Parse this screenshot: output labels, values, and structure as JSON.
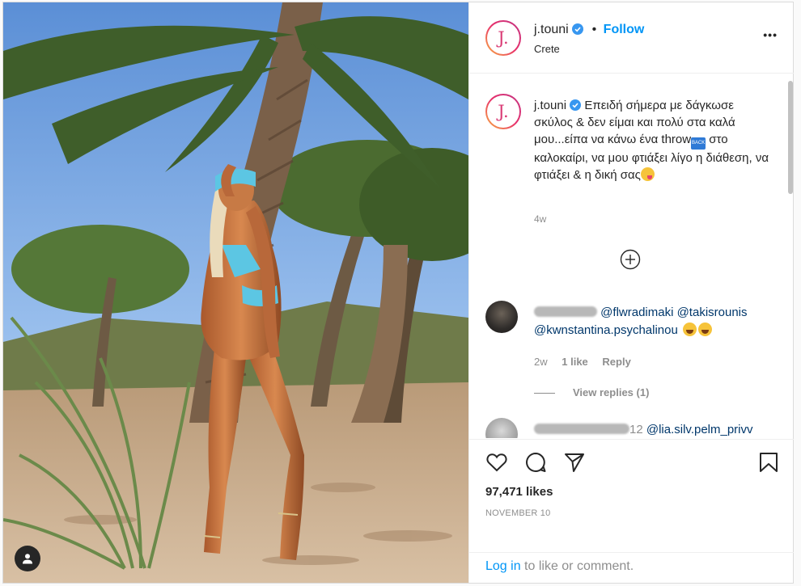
{
  "post": {
    "username": "j.touni",
    "avatar_letter": "J.",
    "location": "Crete",
    "follow_label": "Follow",
    "more_label": "•••",
    "caption": {
      "text_1": "Επειδή σήμερα με δάγκωσε σκύλος & δεν είμαι και πολύ στα καλά μου...είπα να κάνω ένα throw",
      "back_emoji": "BACK",
      "text_2": " στο καλοκαίρι, να μου φτιάξει λίγο η διάθεση, να φτιάξει & η δική σας",
      "time": "4w"
    },
    "comments": [
      {
        "mentions_1": "@flwradimaki @takisrounis",
        "mentions_2": "@kwnstantina.psychalinou",
        "time": "2w",
        "likes": "1 like",
        "reply_label": "Reply",
        "view_replies": "View replies (1)"
      },
      {
        "username_suffix": "12",
        "mentions_1": "@lia.silv.pelm_privv"
      }
    ],
    "likes": "97,471 likes",
    "date": "NOVEMBER 10",
    "login_link": "Log in",
    "login_text": " to like or comment.",
    "icons": [
      "heart-icon",
      "comment-icon",
      "share-icon",
      "bookmark-icon",
      "add-comment-icon",
      "verified-badge-icon",
      "user-tag-icon"
    ]
  }
}
